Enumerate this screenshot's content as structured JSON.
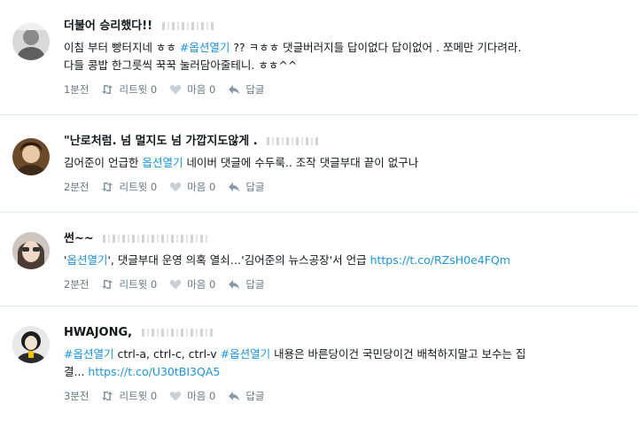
{
  "tweets": [
    {
      "name": "더불어 승리했다!!",
      "text_lines": [
        {
          "parts": [
            {
              "t": "이침 부터 빵터지네 ㅎㅎ ",
              "type": "plain"
            },
            {
              "t": "#옵션열기",
              "type": "hashtag"
            },
            {
              "t": " ?? ㅋㅎㅎ 댓글버러지들 답이없다 답이없어 . 쪼메만 기다려라.",
              "type": "plain"
            }
          ]
        },
        {
          "parts": [
            {
              "t": "다들 콩밥 한그릇씩 꾹꾹 눌러담아줄테니. ㅎㅎ^^",
              "type": "plain"
            }
          ]
        }
      ],
      "time": "1분전",
      "retweet_label": "리트윗 0",
      "like_label": "마음 0",
      "reply_label": "답글"
    },
    {
      "name": "\"난로처럼. 넘 멀지도 넘 가깝지도않게 .",
      "text_lines": [
        {
          "parts": [
            {
              "t": "김어준이 언급한 ",
              "type": "plain"
            },
            {
              "t": "옵션열기",
              "type": "hashtag"
            },
            {
              "t": " 네이버 댓글에 수두룩.. 조작 댓글부대 끝이 없구나",
              "type": "plain"
            }
          ]
        }
      ],
      "time": "2분전",
      "retweet_label": "리트윗 0",
      "like_label": "마음 0",
      "reply_label": "답글"
    },
    {
      "name": "썬~~",
      "text_lines": [
        {
          "parts": [
            {
              "t": "'",
              "type": "plain"
            },
            {
              "t": "옵션열기",
              "type": "hashtag"
            },
            {
              "t": "', 댓글부대 운영 의혹 열쇠…'김어준의 뉴스공장'서 언급 ",
              "type": "plain"
            },
            {
              "t": "https://t.co/RZsH0e4FQm",
              "type": "link"
            }
          ]
        }
      ],
      "time": "2분전",
      "retweet_label": "리트윗 0",
      "like_label": "마음 0",
      "reply_label": "답글"
    },
    {
      "name": "HWAJONG,",
      "text_lines": [
        {
          "parts": [
            {
              "t": "#옵션열기",
              "type": "hashtag"
            },
            {
              "t": " ctrl-a, ctrl-c, ctrl-v ",
              "type": "plain"
            },
            {
              "t": "#옵션열기",
              "type": "hashtag"
            },
            {
              "t": " 내용은 바른당이건 국민당이건 배척하지말고 보수는 집",
              "type": "plain"
            }
          ]
        },
        {
          "parts": [
            {
              "t": "결... ",
              "type": "plain"
            },
            {
              "t": "https://t.co/U30tBI3QA5",
              "type": "link"
            }
          ]
        }
      ],
      "time": "3분전",
      "retweet_label": "리트윗 0",
      "like_label": "마음 0",
      "reply_label": "답글"
    }
  ],
  "colors": {
    "hashtag": "#1b95e0",
    "meta": "#657786",
    "divider": "#e1e8ed"
  },
  "icons": {
    "retweet": "retweet-icon",
    "like": "heart-icon",
    "reply": "reply-icon"
  }
}
